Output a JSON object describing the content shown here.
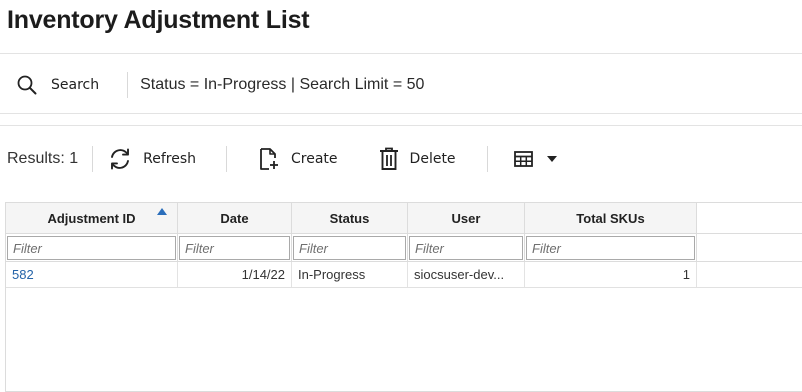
{
  "page": {
    "title": "Inventory Adjustment List"
  },
  "search": {
    "label": "Search",
    "criteria": "Status = In-Progress | Search Limit = 50"
  },
  "toolbar": {
    "results": "Results: 1",
    "refresh_label": "Refresh",
    "create_label": "Create",
    "delete_label": "Delete",
    "view_icon": "table-grid-icon"
  },
  "table": {
    "columns": [
      "Adjustment ID",
      "Date",
      "Status",
      "User",
      "Total SKUs"
    ],
    "filter_placeholder": "Filter",
    "sort": {
      "column": "Adjustment ID",
      "direction": "ascending"
    },
    "rows": [
      {
        "adjustment_id": "582",
        "date": "1/14/22",
        "status": "In-Progress",
        "user": "siocsuser-dev...",
        "total_skus": "1"
      }
    ]
  },
  "colors": {
    "link": "#2463a8",
    "sort_indicator": "#2a6ebb"
  }
}
